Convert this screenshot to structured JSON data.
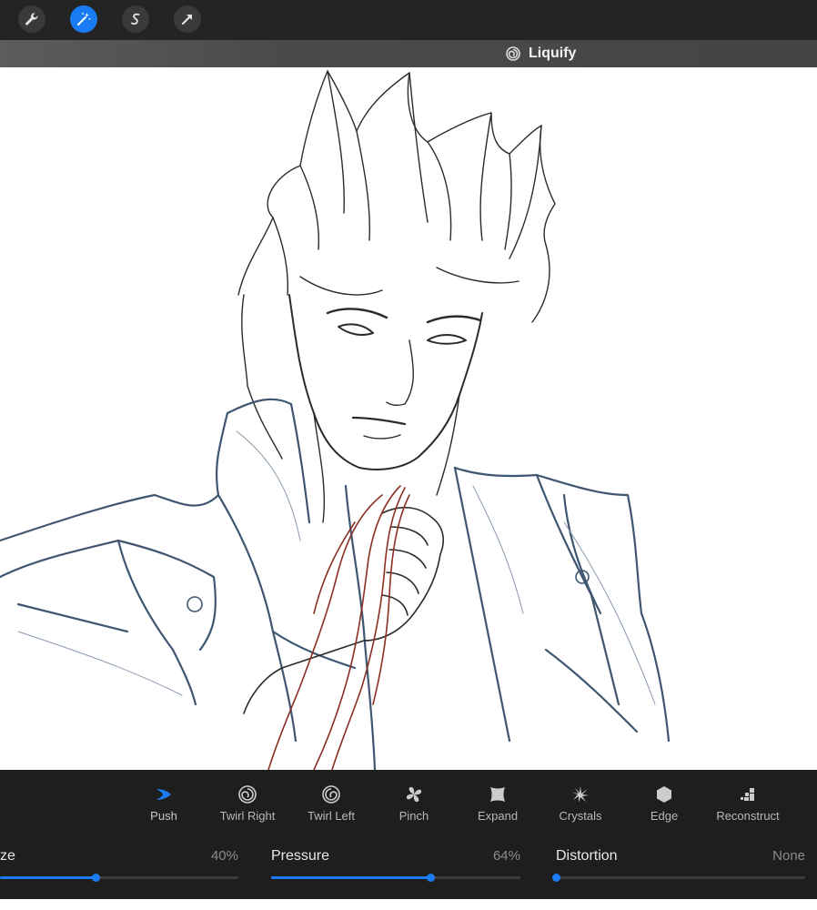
{
  "toolbar": {
    "buttons": [
      {
        "name": "wrench-icon",
        "active": false
      },
      {
        "name": "magic-wand-icon",
        "active": true
      },
      {
        "name": "selection-s-icon",
        "active": false
      },
      {
        "name": "transform-arrow-icon",
        "active": false
      }
    ]
  },
  "mode": {
    "label": "Liquify",
    "icon": "liquify-swirl-icon"
  },
  "liquify_tools": [
    {
      "label": "Push",
      "icon": "push-icon",
      "active": true
    },
    {
      "label": "Twirl Right",
      "icon": "twirl-right-icon",
      "active": false
    },
    {
      "label": "Twirl Left",
      "icon": "twirl-left-icon",
      "active": false
    },
    {
      "label": "Pinch",
      "icon": "pinch-icon",
      "active": false
    },
    {
      "label": "Expand",
      "icon": "expand-icon",
      "active": false
    },
    {
      "label": "Crystals",
      "icon": "crystals-icon",
      "active": false
    },
    {
      "label": "Edge",
      "icon": "edge-icon",
      "active": false
    },
    {
      "label": "Reconstruct",
      "icon": "reconstruct-icon",
      "active": false
    }
  ],
  "sliders": {
    "size": {
      "label": "ze",
      "value_text": "40%",
      "level": 0.4
    },
    "pressure": {
      "label": "Pressure",
      "value_text": "64%",
      "level": 0.64
    },
    "distortion": {
      "label": "Distortion",
      "value_text": "None",
      "level": 0.0
    }
  },
  "colors": {
    "accent": "#1a7cf2",
    "panel": "#1e1e1e",
    "topbar": "#242424",
    "sketch_blue": "#3f5670",
    "sketch_red": "#8a2f25"
  }
}
